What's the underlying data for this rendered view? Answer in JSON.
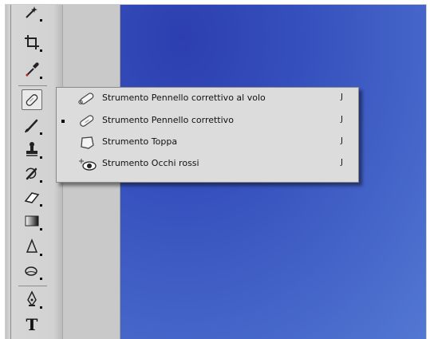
{
  "flyout_menu": {
    "items": [
      {
        "label": "Strumento Pennello correttivo al volo",
        "shortcut": "J",
        "icon": "spot-healing-brush-icon",
        "selected": false
      },
      {
        "label": "Strumento Pennello correttivo",
        "shortcut": "J",
        "icon": "healing-brush-icon",
        "selected": true
      },
      {
        "label": "Strumento Toppa",
        "shortcut": "J",
        "icon": "patch-icon",
        "selected": false
      },
      {
        "label": "Strumento Occhi rossi",
        "shortcut": "J",
        "icon": "red-eye-icon",
        "selected": false
      }
    ]
  },
  "toolbar": {
    "tools": [
      {
        "icon": "magic-wand-icon"
      },
      {
        "icon": "crop-icon"
      },
      {
        "icon": "eyedropper-icon"
      },
      {
        "icon": "healing-brush-icon",
        "active": true
      },
      {
        "icon": "brush-icon"
      },
      {
        "icon": "clone-stamp-icon"
      },
      {
        "icon": "history-brush-icon"
      },
      {
        "icon": "eraser-icon"
      },
      {
        "icon": "gradient-icon"
      },
      {
        "icon": "blur-icon"
      },
      {
        "icon": "dodge-icon"
      },
      {
        "icon": "pen-icon"
      },
      {
        "icon": "type-icon",
        "glyph": "T"
      }
    ]
  },
  "colors": {
    "canvas_blue": "#3a55c0",
    "menu_bg": "#dcdcdc",
    "toolbar_bg": "#d2d2d2"
  }
}
